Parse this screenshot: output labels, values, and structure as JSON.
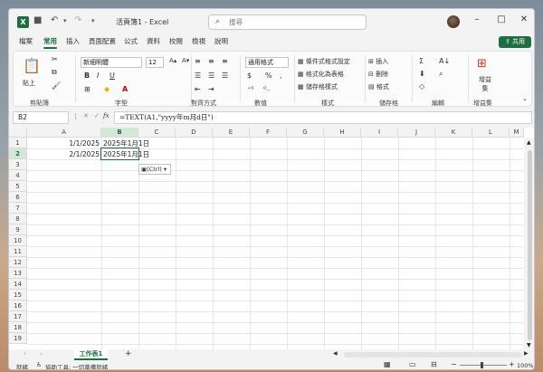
{
  "title": "活頁簿1 - Excel",
  "app_icon": "X",
  "search": {
    "placeholder": "搜尋"
  },
  "share_label": "共用",
  "menu": [
    "檔案",
    "常用",
    "插入",
    "頁面配置",
    "公式",
    "資料",
    "校閱",
    "檢視",
    "說明"
  ],
  "ribbon": {
    "paste_label": "貼上",
    "clipboard": "剪貼簿",
    "font_group": "字型",
    "font_name": "新細明體",
    "font_size": "12",
    "bold": "B",
    "italic": "I",
    "underline": "U",
    "align_group": "對齊方式",
    "number_group": "數值",
    "number_format": "通用格式",
    "cond_format": "條件式格式設定",
    "format_table": "格式化為表格",
    "cell_styles": "儲存格樣式",
    "styles_group": "樣式",
    "insert": "插入",
    "delete": "刪除",
    "format": "格式",
    "cells_group": "儲存格",
    "edit_group": "編輯",
    "addin": "增益集",
    "addin_group": "增益集"
  },
  "formula_bar": {
    "name_box": "B2",
    "fx": "fx",
    "formula": "=TEXT(A1,\"yyyy年m月d日\")"
  },
  "columns": [
    "A",
    "B",
    "C",
    "D",
    "E",
    "F",
    "G",
    "H",
    "I",
    "J",
    "K",
    "L",
    "M"
  ],
  "rows": [
    "1",
    "2",
    "3",
    "4",
    "5",
    "6",
    "7",
    "8",
    "9",
    "10",
    "11",
    "12",
    "13",
    "14",
    "15",
    "16",
    "17",
    "18",
    "19"
  ],
  "cells": {
    "A1": "1/1/2025",
    "A2": "2/1/2025",
    "B1": "2025年1月1日",
    "B2": "2025年1月1日"
  },
  "paste_tag": "(Ctrl)",
  "sheet_tab": "工作表1",
  "status": {
    "ready": "就緒",
    "accessibility": "協助工具: 一切準備就緒",
    "zoom": "100%"
  }
}
